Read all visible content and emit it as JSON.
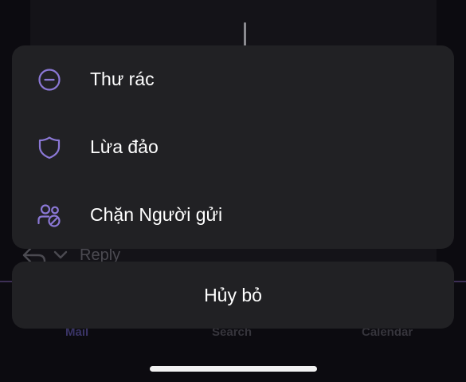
{
  "background_app": {
    "reply_label": "Reply",
    "tabs": [
      {
        "label": "Mail"
      },
      {
        "label": "Search"
      },
      {
        "label": "Calendar"
      }
    ]
  },
  "action_sheet": {
    "items": [
      {
        "label": "Thư rác",
        "icon": "minus-circle-icon"
      },
      {
        "label": "Lừa đảo",
        "icon": "shield-icon"
      },
      {
        "label": "Chặn Người gửi",
        "icon": "block-user-icon"
      }
    ],
    "cancel_label": "Hủy bỏ"
  },
  "colors": {
    "accent": "#8b78d6",
    "sheet_bg": "#212124",
    "background": "#0c0b10",
    "text": "#ffffff"
  }
}
